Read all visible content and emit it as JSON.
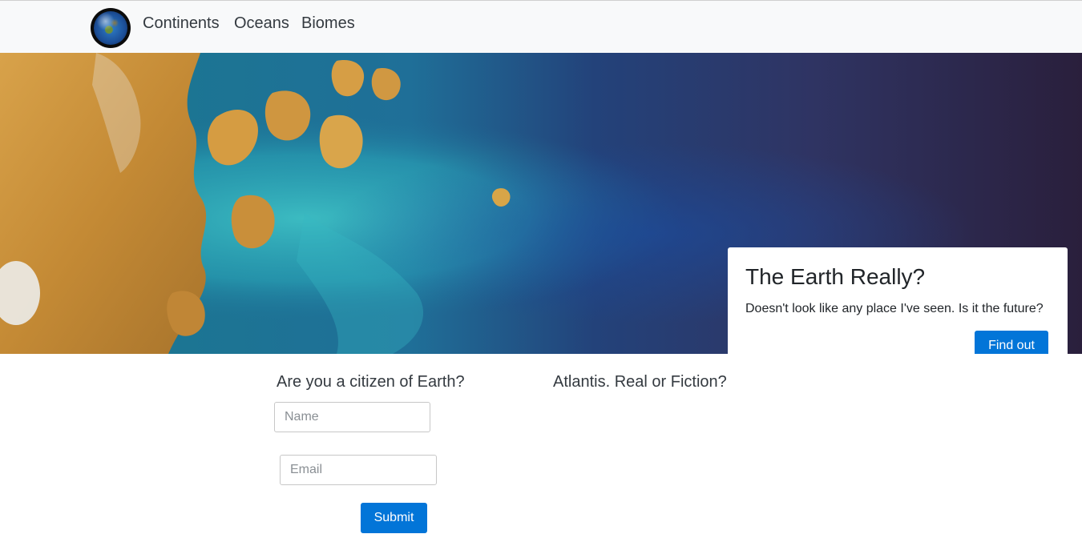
{
  "navbar": {
    "logo_icon": "earth-globe-icon",
    "links": [
      {
        "label": "Continents"
      },
      {
        "label": "Oceans"
      },
      {
        "label": "Biomes"
      }
    ]
  },
  "hero": {
    "image": "satellite-view-of-coastline",
    "card": {
      "title": "The Earth Really?",
      "text": "Doesn't look like any place I've seen. Is it the future?",
      "button_label": "Find out"
    }
  },
  "citizen_form": {
    "heading": "Are you a citizen of Earth?",
    "name_placeholder": "Name",
    "email_placeholder": "Email",
    "submit_label": "Submit"
  },
  "atlantis": {
    "heading": "Atlantis. Real or Fiction?"
  },
  "colors": {
    "primary_button": "#0275d8",
    "navbar_bg": "#f8f9fa"
  }
}
